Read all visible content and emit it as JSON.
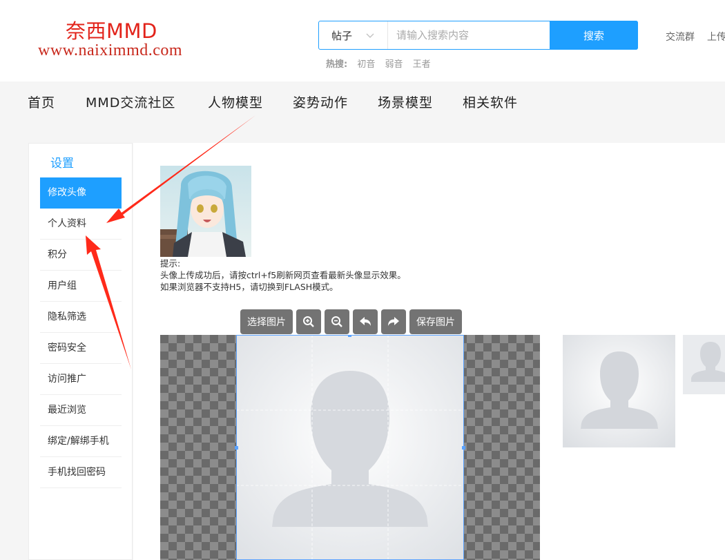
{
  "logo": {
    "cn": "奈西MMD",
    "url": "www.naiximmd.com"
  },
  "search": {
    "type": "帖子",
    "placeholder": "请输入搜索内容",
    "button": "搜索"
  },
  "hot": {
    "label": "热搜:",
    "keywords": [
      "初音",
      "弱音",
      "王者"
    ]
  },
  "top_links": [
    "交流群",
    "上传"
  ],
  "nav": [
    "首页",
    "MMD交流社区",
    "人物模型",
    "姿势动作",
    "场景模型",
    "相关软件"
  ],
  "sidebar": {
    "title": "设置",
    "items": [
      "修改头像",
      "个人资料",
      "积分",
      "用户组",
      "隐私筛选",
      "密码安全",
      "访问推广",
      "最近浏览",
      "绑定/解绑手机",
      "手机找回密码"
    ]
  },
  "tips": {
    "title": "提示:",
    "line1": "头像上传成功后，请按ctrl+f5刷新网页查看最新头像显示效果。",
    "line2": "如果浏览器不支持H5，请切换到FLASH模式。"
  },
  "toolbar": {
    "select": "选择图片",
    "save": "保存图片"
  },
  "icons": [
    "chevron-down-icon",
    "zoom-in-icon",
    "zoom-out-icon",
    "rotate-left-icon",
    "rotate-right-icon",
    "avatar-silhouette-icon"
  ],
  "colors": {
    "accent": "#1e9fff",
    "logo_red": "#e2231a",
    "annotation_arrow": "#ff2a1a",
    "toolbar_button": "#737373"
  }
}
